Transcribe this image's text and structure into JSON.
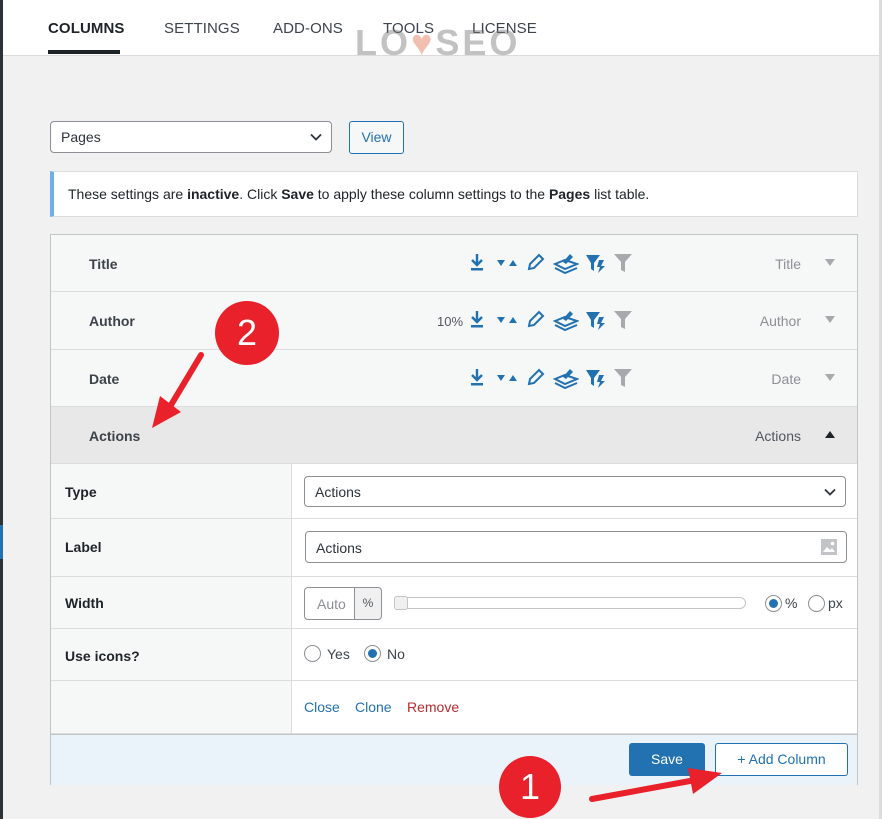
{
  "tabs": [
    {
      "label": "COLUMNS",
      "active": true
    },
    {
      "label": "SETTINGS"
    },
    {
      "label": "ADD-ONS"
    },
    {
      "label": "TOOLS"
    },
    {
      "label": "LICENSE"
    }
  ],
  "watermark": {
    "text_a": "LO",
    "text_b": "SEO"
  },
  "list_select": {
    "value": "Pages"
  },
  "view_button": "View",
  "notice": {
    "p1": "These settings are ",
    "b1": "inactive",
    "p2": ". Click ",
    "b2": "Save",
    "p3": " to apply these column settings to the ",
    "b3": "Pages",
    "p4": " list table."
  },
  "columns": [
    {
      "name": "Title",
      "type": "Title",
      "width_label": ""
    },
    {
      "name": "Author",
      "type": "Author",
      "width_label": "10%"
    },
    {
      "name": "Date",
      "type": "Date",
      "width_label": ""
    },
    {
      "name": "Actions",
      "type": "Actions",
      "expanded": true
    }
  ],
  "settings": {
    "type": {
      "label": "Type",
      "value": "Actions"
    },
    "label": {
      "label": "Label",
      "value": "Actions"
    },
    "width": {
      "label": "Width",
      "placeholder": "Auto",
      "unit": "%",
      "slider_value": 0,
      "unit_pct": "%",
      "unit_px": "px",
      "selected_unit": "%"
    },
    "use_icons": {
      "label": "Use icons?",
      "yes": "Yes",
      "no": "No",
      "selected": "No"
    },
    "actions": {
      "close": "Close",
      "clone": "Clone",
      "remove": "Remove"
    }
  },
  "footer": {
    "save": "Save",
    "add_column": "+ Add Column"
  },
  "annotations": {
    "badge_1": "1",
    "badge_2": "2",
    "color": "#e8212b"
  },
  "colors": {
    "accent": "#2271b1",
    "remove": "#b32d2e",
    "notice_border": "#72aee6"
  }
}
